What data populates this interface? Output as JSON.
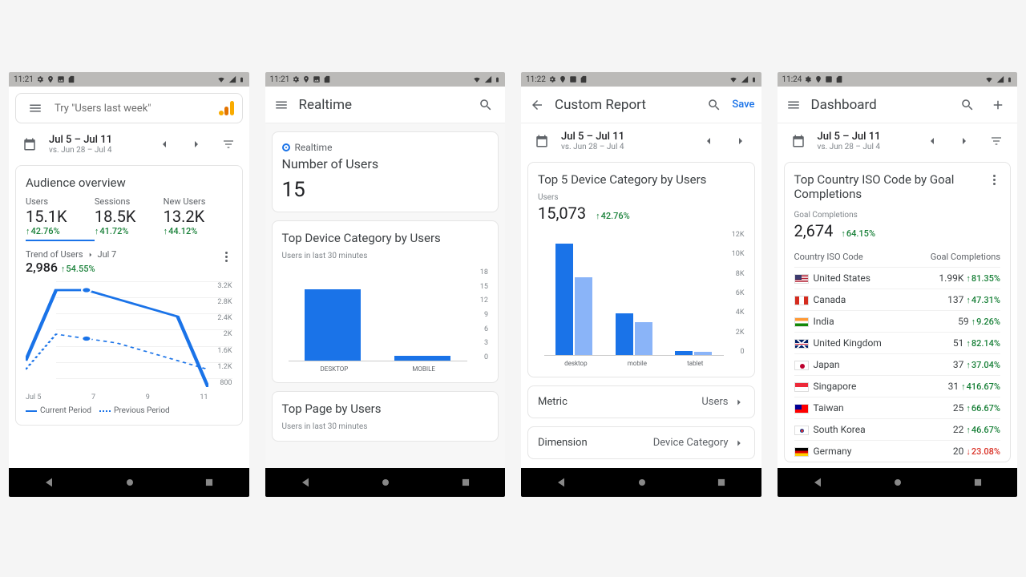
{
  "screens": [
    {
      "time": "11:21"
    },
    {
      "time": "11:21"
    },
    {
      "time": "11:22"
    },
    {
      "time": "11:24"
    }
  ],
  "s1": {
    "search_placeholder": "Try \"Users last week\"",
    "date_range": "Jul 5 – Jul 11",
    "date_compare": "vs. Jun 28 – Jul 4",
    "card_title": "Audience overview",
    "metrics": [
      {
        "label": "Users",
        "value": "15.1K",
        "delta": "42.76%"
      },
      {
        "label": "Sessions",
        "value": "18.5K",
        "delta": "41.72%"
      },
      {
        "label": "New Users",
        "value": "13.2K",
        "delta": "44.12%"
      }
    ],
    "trend_label": "Trend of Users",
    "trend_day": "Jul 7",
    "trend_value": "2,986",
    "trend_delta": "54.55%",
    "legend_cur": "Current Period",
    "legend_prev": "Previous Period"
  },
  "s2": {
    "title": "Realtime",
    "card1_title": "Realtime",
    "card1_metric": "Number of Users",
    "card1_value": "15",
    "card2_title": "Top Device Category by Users",
    "card2_sub": "Users in last 30 minutes",
    "card3_title": "Top Page by Users",
    "card3_sub": "Users in last 30 minutes"
  },
  "s3": {
    "title": "Custom Report",
    "save": "Save",
    "date_range": "Jul 5 – Jul 11",
    "date_compare": "vs. Jun 28 – Jul 4",
    "card_title": "Top 5 Device Category by Users",
    "card_sub": "Users",
    "card_value": "15,073",
    "card_delta": "42.76%",
    "row_metric_l": "Metric",
    "row_metric_v": "Users",
    "row_dim_l": "Dimension",
    "row_dim_v": "Device Category"
  },
  "s4": {
    "title": "Dashboard",
    "date_range": "Jul 5 – Jul 11",
    "date_compare": "vs. Jun 28 – Jul 4",
    "card_title": "Top Country ISO Code by Goal Completions",
    "card_sub": "Goal Completions",
    "card_value": "2,674",
    "card_delta": "64.15%",
    "col1": "Country ISO Code",
    "col2": "Goal Completions",
    "rows": [
      {
        "flag": "us",
        "name": "United States",
        "val": "1.99K",
        "delta": "81.35%",
        "dir": "up"
      },
      {
        "flag": "ca",
        "name": "Canada",
        "val": "137",
        "delta": "47.31%",
        "dir": "up"
      },
      {
        "flag": "in",
        "name": "India",
        "val": "59",
        "delta": "9.26%",
        "dir": "up"
      },
      {
        "flag": "gb",
        "name": "United Kingdom",
        "val": "51",
        "delta": "82.14%",
        "dir": "up"
      },
      {
        "flag": "jp",
        "name": "Japan",
        "val": "37",
        "delta": "37.04%",
        "dir": "up"
      },
      {
        "flag": "sg",
        "name": "Singapore",
        "val": "31",
        "delta": "416.67%",
        "dir": "up"
      },
      {
        "flag": "tw",
        "name": "Taiwan",
        "val": "25",
        "delta": "66.67%",
        "dir": "up"
      },
      {
        "flag": "kr",
        "name": "South Korea",
        "val": "22",
        "delta": "46.67%",
        "dir": "up"
      },
      {
        "flag": "de",
        "name": "Germany",
        "val": "20",
        "delta": "23.08%",
        "dir": "down"
      }
    ]
  },
  "chart_data": [
    {
      "id": "s1_line",
      "type": "line",
      "x": [
        "Jul 5",
        "6",
        "7",
        "8",
        "9",
        "10",
        "11"
      ],
      "series": [
        {
          "name": "Current Period",
          "values": [
            1400,
            3000,
            3000,
            2800,
            2600,
            2400,
            800
          ]
        },
        {
          "name": "Previous Period",
          "values": [
            1200,
            2000,
            1900,
            1800,
            1600,
            1400,
            1200
          ]
        }
      ],
      "ylim": [
        800,
        3200
      ],
      "yticks": [
        "3.2K",
        "2.8K",
        "2.4K",
        "2K",
        "1.6K",
        "1.2K",
        "800"
      ],
      "xlabels": [
        "Jul 5",
        "7",
        "9",
        "11"
      ],
      "highlight_x": "7"
    },
    {
      "id": "s2_bar",
      "type": "bar",
      "categories": [
        "DESKTOP",
        "MOBILE"
      ],
      "values": [
        14,
        1
      ],
      "ylim": [
        0,
        18
      ],
      "yticks": [
        "18",
        "15",
        "12",
        "9",
        "6",
        "3",
        "0"
      ]
    },
    {
      "id": "s3_bar",
      "type": "bar",
      "categories": [
        "desktop",
        "mobile",
        "tablet"
      ],
      "series": [
        {
          "name": "Current",
          "values": [
            10800,
            4000,
            400
          ]
        },
        {
          "name": "Previous",
          "values": [
            7500,
            3200,
            300
          ]
        }
      ],
      "ylim": [
        0,
        12000
      ],
      "yticks": [
        "12K",
        "10K",
        "8K",
        "6K",
        "4K",
        "2K",
        "0"
      ]
    }
  ]
}
